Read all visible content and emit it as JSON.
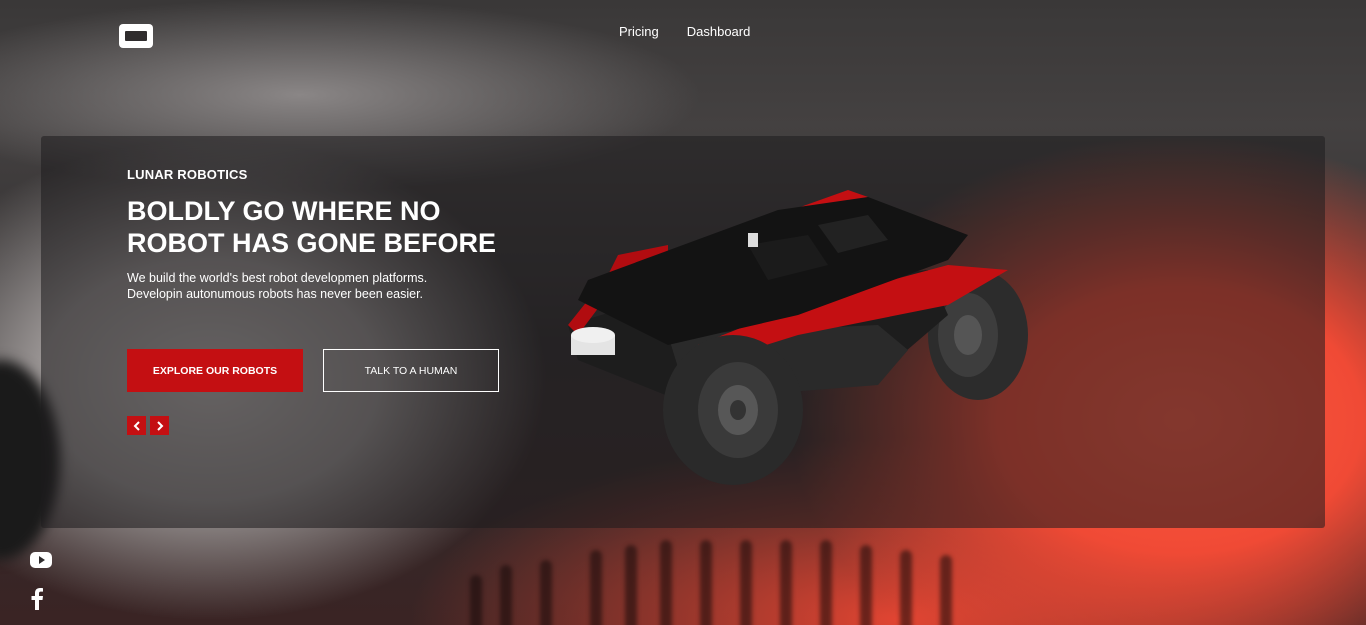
{
  "nav": {
    "items": [
      {
        "label": "Pricing"
      },
      {
        "label": "Dashboard"
      }
    ]
  },
  "hero": {
    "brand": "LUNAR ROBOTICS",
    "headline_line1": "BOLDLY GO WHERE NO",
    "headline_line2": "ROBOT HAS GONE BEFORE",
    "sub_line1": "We build the world's best robot developmen platforms.",
    "sub_line2": "Developin autonumous robots has never been easier.",
    "primary_button": "EXPLORE OUR ROBOTS",
    "secondary_button": "TALK TO A HUMAN"
  },
  "icons": {
    "logo": "logo-icon",
    "prev": "chevron-left-icon",
    "next": "chevron-right-icon",
    "youtube": "youtube-icon",
    "facebook": "facebook-icon"
  },
  "colors": {
    "accent": "#c40f12",
    "text": "#ffffff"
  }
}
